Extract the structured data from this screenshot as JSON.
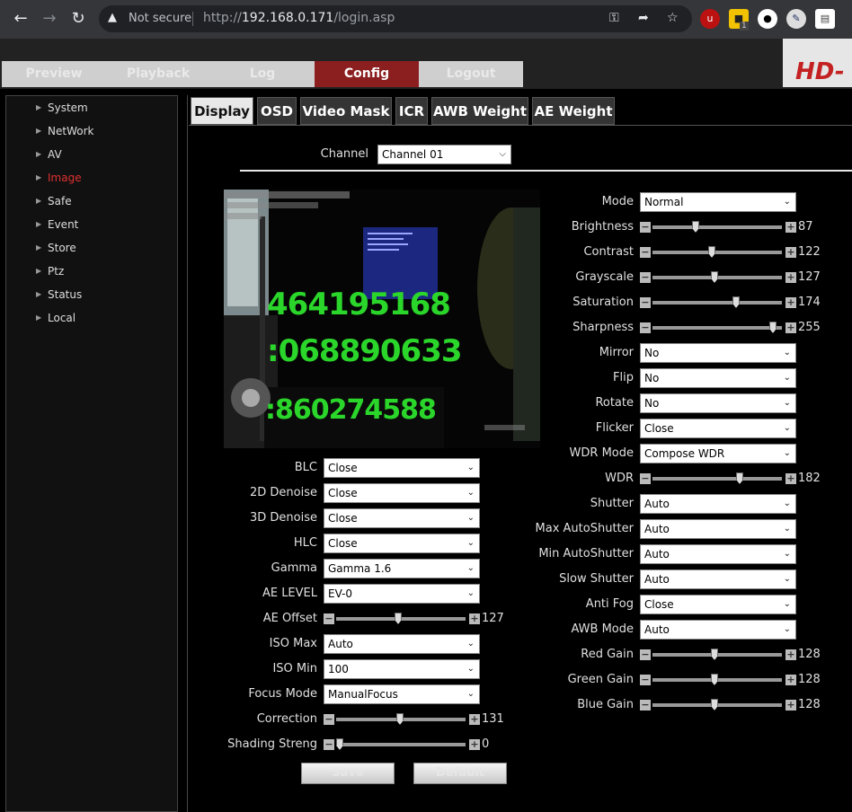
{
  "browser": {
    "security_label": "Not secure",
    "url_prefix": "http://",
    "url_host": "192.168.0.171",
    "url_path": "/login.asp",
    "ext_badge": "1"
  },
  "nav_tabs": [
    "Preview",
    "Playback",
    "Log",
    "Config",
    "Logout"
  ],
  "brand": "HD-",
  "sidebar": [
    {
      "label": "System"
    },
    {
      "label": "NetWork"
    },
    {
      "label": "AV"
    },
    {
      "label": "Image"
    },
    {
      "label": "Safe"
    },
    {
      "label": "Event"
    },
    {
      "label": "Store"
    },
    {
      "label": "Ptz"
    },
    {
      "label": "Status"
    },
    {
      "label": "Local"
    }
  ],
  "page_tabs": [
    "Display",
    "OSD",
    "Video Mask",
    "ICR",
    "AWB Weight",
    "AE Weight"
  ],
  "channel": {
    "label": "Channel",
    "value": "Channel 01"
  },
  "video": {
    "digits1": "464195168",
    "digits2": ":068890633",
    "digits3": ":860274588"
  },
  "left_fields": [
    {
      "label": "BLC",
      "value": "Close"
    },
    {
      "label": "2D Denoise",
      "value": "Close"
    },
    {
      "label": "3D Denoise",
      "value": "Close"
    },
    {
      "label": "HLC",
      "value": "Close"
    },
    {
      "label": "Gamma",
      "value": "Gamma 1.6"
    },
    {
      "label": "AE LEVEL",
      "value": "EV-0"
    },
    {
      "label": "AE Offset",
      "slider": "127",
      "level": 127,
      "max": 255
    },
    {
      "label": "ISO Max",
      "value": "Auto"
    },
    {
      "label": "ISO Min",
      "value": "100"
    },
    {
      "label": "Focus Mode",
      "value": "ManualFocus"
    },
    {
      "label": "Correction",
      "slider": "131",
      "level": 131,
      "max": 255
    },
    {
      "label": "Shading Streng",
      "slider": "0",
      "level": 0,
      "max": 255
    }
  ],
  "right_fields": [
    {
      "label": "Mode",
      "value": "Normal"
    },
    {
      "label": "Brightness",
      "slider": "87",
      "level": 87,
      "max": 255
    },
    {
      "label": "Contrast",
      "slider": "122",
      "level": 122,
      "max": 255
    },
    {
      "label": "Grayscale",
      "slider": "127",
      "level": 127,
      "max": 255
    },
    {
      "label": "Saturation",
      "slider": "174",
      "level": 174,
      "max": 255
    },
    {
      "label": "Sharpness",
      "slider": "255",
      "level": 255,
      "max": 255
    },
    {
      "label": "Mirror",
      "value": "No"
    },
    {
      "label": "Flip",
      "value": "No"
    },
    {
      "label": "Rotate",
      "value": "No"
    },
    {
      "label": "Flicker",
      "value": "Close"
    },
    {
      "label": "WDR Mode",
      "value": "Compose WDR"
    },
    {
      "label": "WDR",
      "slider": "182",
      "level": 182,
      "max": 255
    },
    {
      "label": "Shutter",
      "value": "Auto"
    },
    {
      "label": "Max AutoShutter",
      "value": "Auto"
    },
    {
      "label": "Min AutoShutter",
      "value": "Auto"
    },
    {
      "label": "Slow Shutter",
      "value": "Auto"
    },
    {
      "label": "Anti Fog",
      "value": "Close"
    },
    {
      "label": "AWB Mode",
      "value": "Auto"
    },
    {
      "label": "Red Gain",
      "slider": "128",
      "level": 128,
      "max": 255
    },
    {
      "label": "Green Gain",
      "slider": "128",
      "level": 128,
      "max": 255
    },
    {
      "label": "Blue Gain",
      "slider": "128",
      "level": 128,
      "max": 255
    }
  ],
  "buttons": {
    "save": "Save",
    "default": "Default"
  },
  "colors": {
    "active_tab": "#8b1f20",
    "active_sidebar": "#e03030",
    "osd_green": "#2bd62b"
  }
}
